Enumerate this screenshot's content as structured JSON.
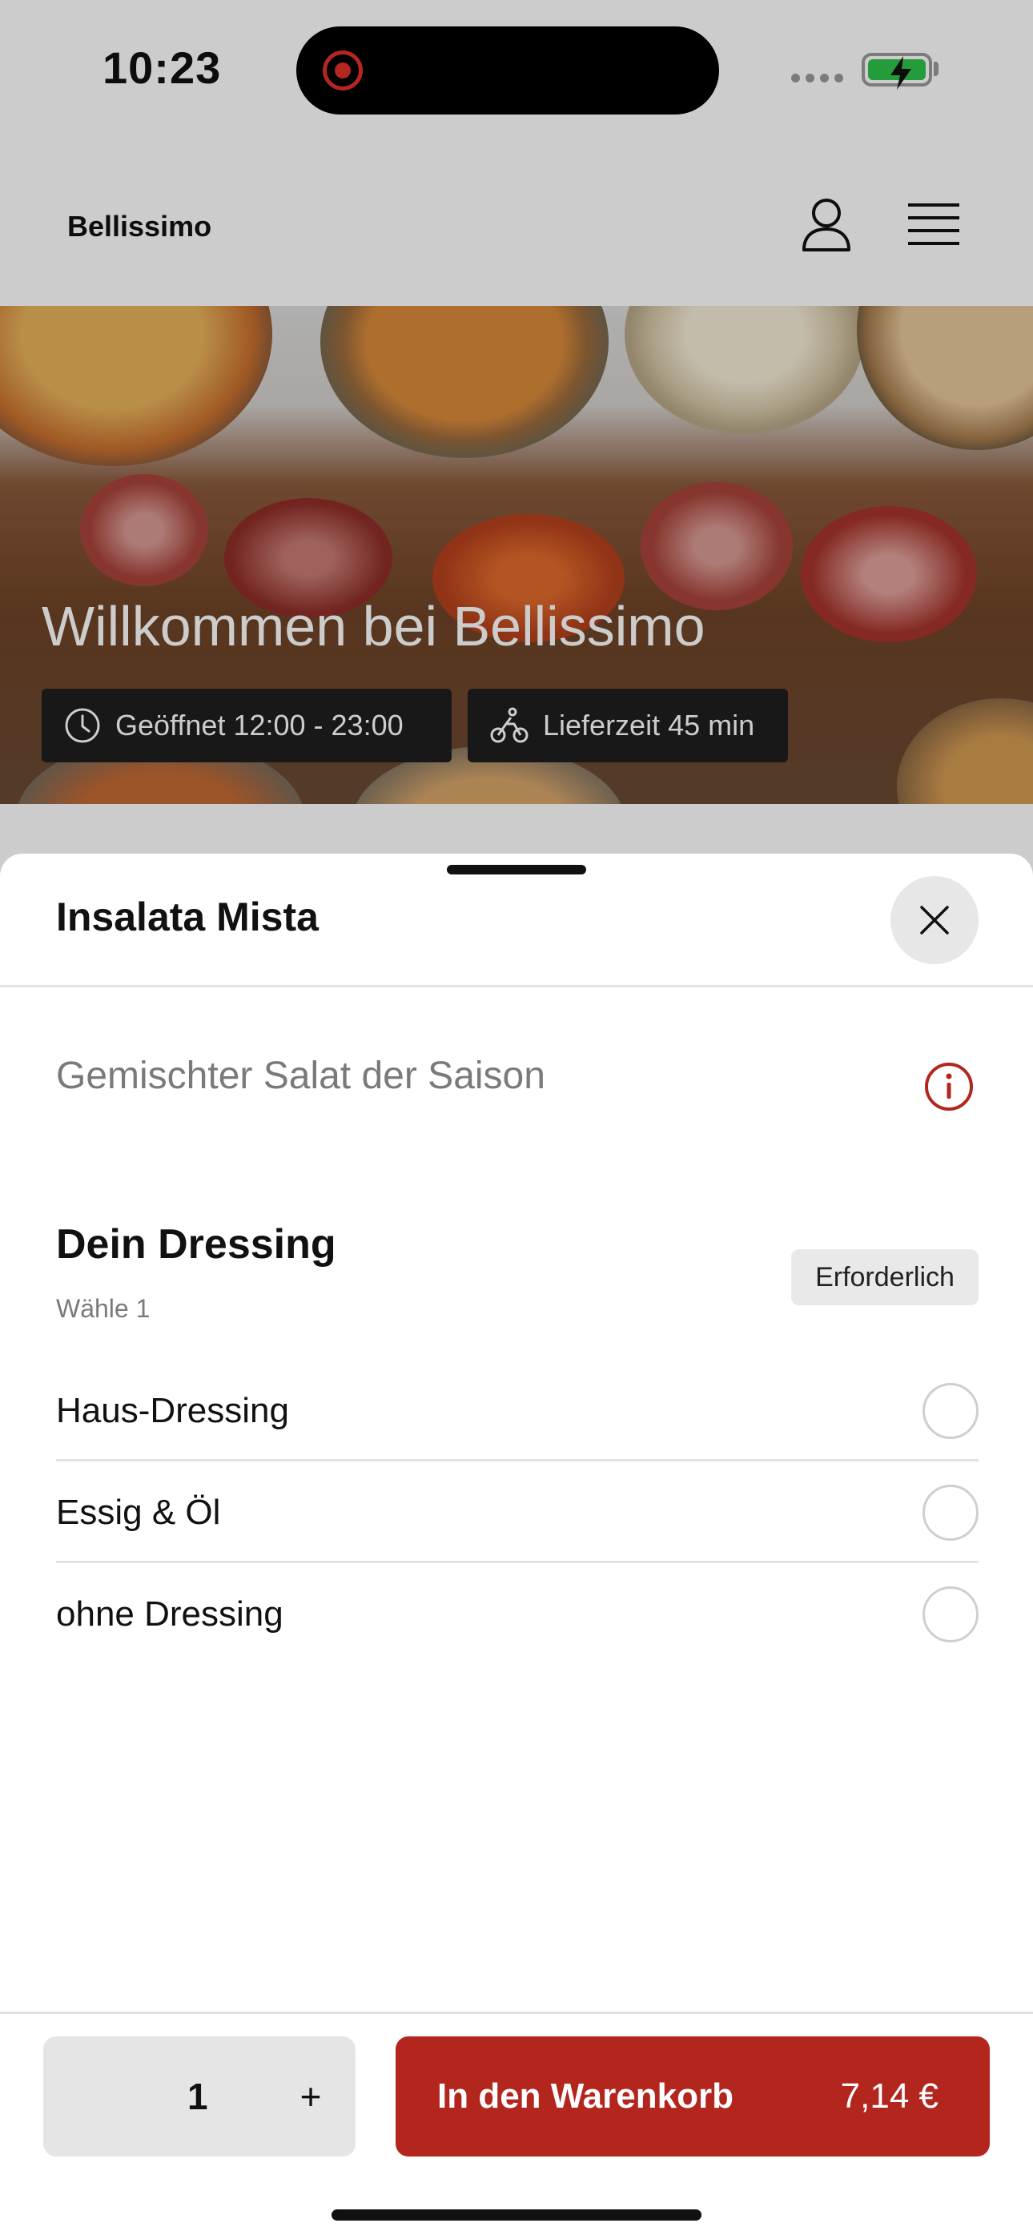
{
  "status_bar": {
    "time": "10:23"
  },
  "header": {
    "brand": "Bellissimo"
  },
  "hero": {
    "title": "Willkommen bei Bellissimo",
    "opening_hours": "Geöffnet 12:00 - 23:00",
    "delivery_time": "Lieferzeit 45 min"
  },
  "sheet": {
    "title": "Insalata Mista",
    "description": "Gemischter Salat der Saison",
    "group": {
      "title": "Dein Dressing",
      "subtitle": "Wähle 1",
      "required_label": "Erforderlich",
      "options": [
        {
          "label": "Haus-Dressing",
          "selected": false
        },
        {
          "label": "Essig & Öl",
          "selected": false
        },
        {
          "label": "ohne Dressing",
          "selected": false
        }
      ]
    }
  },
  "bottom_bar": {
    "quantity": "1",
    "plus_label": "+",
    "cart_label": "In den Warenkorb",
    "price": "7,14 €"
  },
  "colors": {
    "accent": "#b3261e",
    "info_icon": "#b3261e",
    "battery": "#2ec44a"
  },
  "icons": [
    "record-icon",
    "battery-icon",
    "user-icon",
    "menu-icon",
    "clock-icon",
    "bicycle-icon",
    "close-icon",
    "info-icon"
  ]
}
